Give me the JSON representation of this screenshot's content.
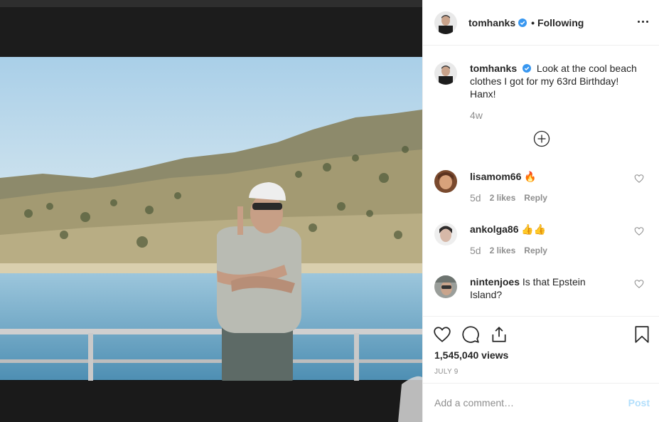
{
  "header": {
    "username": "tomhanks",
    "separator": "•",
    "follow_status": "Following",
    "verified_icon": "verified-badge-icon",
    "more_icon": "more-options-icon"
  },
  "caption": {
    "username": "tomhanks",
    "text": "Look at the cool beach clothes I got for my 63rd Birthday! Hanx!",
    "age": "4w"
  },
  "load_more_icon": "plus-circle-icon",
  "comments": [
    {
      "username": "lisamom66",
      "text": "🔥",
      "age": "5d",
      "likes": "2 likes",
      "reply": "Reply"
    },
    {
      "username": "ankolga86",
      "text": "👍👍",
      "age": "5d",
      "likes": "2 likes",
      "reply": "Reply"
    },
    {
      "username": "nintenjoes",
      "text": "Is that Epstein Island?"
    }
  ],
  "actions": {
    "icons": [
      "heart-icon",
      "comment-icon",
      "share-icon",
      "bookmark-icon"
    ],
    "views": "1,545,040 views",
    "date": "JULY 9"
  },
  "add_comment": {
    "placeholder": "Add a comment…",
    "post_label": "Post"
  },
  "colors": {
    "verified": "#3897f0",
    "post_disabled": "#b2dffc",
    "muted": "#8e8e8e"
  }
}
